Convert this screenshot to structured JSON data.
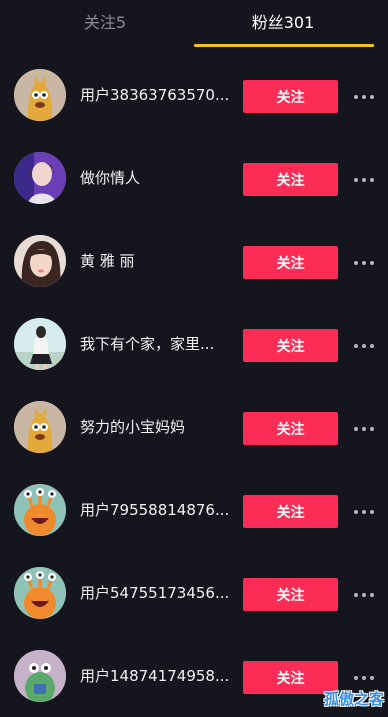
{
  "tabs": {
    "following": "关注5",
    "fans": "粉丝301"
  },
  "follow_label": "关注",
  "users": [
    {
      "name": "用户38363763570...",
      "avatar": "yellow-monster"
    },
    {
      "name": "做你情人",
      "avatar": "photo-purple"
    },
    {
      "name": "黄 雅 丽",
      "avatar": "photo-girl"
    },
    {
      "name": "我下有个家，家里...",
      "avatar": "photo-light"
    },
    {
      "name": "努力的小宝妈妈",
      "avatar": "yellow-monster"
    },
    {
      "name": "用户79558814876...",
      "avatar": "orange-monster"
    },
    {
      "name": "用户54755173456...",
      "avatar": "orange-monster"
    },
    {
      "name": "用户14874174958...",
      "avatar": "green-monster"
    }
  ],
  "watermark": "孤傲之客",
  "colors": {
    "background": "#15151d",
    "follow_button": "#fb2c55",
    "tab_indicator": "#f4c414"
  }
}
